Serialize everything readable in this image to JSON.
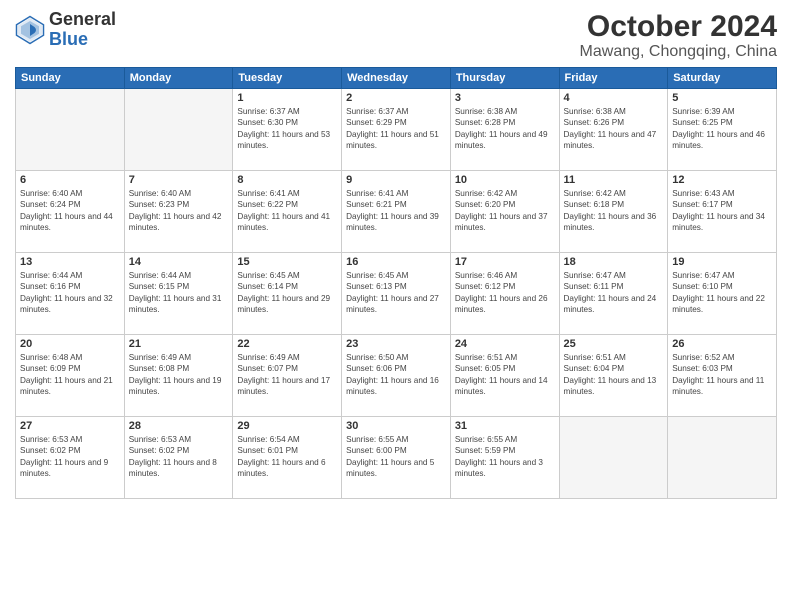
{
  "header": {
    "logo_line1": "General",
    "logo_line2": "Blue",
    "title": "October 2024",
    "subtitle": "Mawang, Chongqing, China"
  },
  "weekdays": [
    "Sunday",
    "Monday",
    "Tuesday",
    "Wednesday",
    "Thursday",
    "Friday",
    "Saturday"
  ],
  "weeks": [
    [
      {
        "day": "",
        "sunrise": "",
        "sunset": "",
        "daylight": ""
      },
      {
        "day": "",
        "sunrise": "",
        "sunset": "",
        "daylight": ""
      },
      {
        "day": "1",
        "sunrise": "Sunrise: 6:37 AM",
        "sunset": "Sunset: 6:30 PM",
        "daylight": "Daylight: 11 hours and 53 minutes."
      },
      {
        "day": "2",
        "sunrise": "Sunrise: 6:37 AM",
        "sunset": "Sunset: 6:29 PM",
        "daylight": "Daylight: 11 hours and 51 minutes."
      },
      {
        "day": "3",
        "sunrise": "Sunrise: 6:38 AM",
        "sunset": "Sunset: 6:28 PM",
        "daylight": "Daylight: 11 hours and 49 minutes."
      },
      {
        "day": "4",
        "sunrise": "Sunrise: 6:38 AM",
        "sunset": "Sunset: 6:26 PM",
        "daylight": "Daylight: 11 hours and 47 minutes."
      },
      {
        "day": "5",
        "sunrise": "Sunrise: 6:39 AM",
        "sunset": "Sunset: 6:25 PM",
        "daylight": "Daylight: 11 hours and 46 minutes."
      }
    ],
    [
      {
        "day": "6",
        "sunrise": "Sunrise: 6:40 AM",
        "sunset": "Sunset: 6:24 PM",
        "daylight": "Daylight: 11 hours and 44 minutes."
      },
      {
        "day": "7",
        "sunrise": "Sunrise: 6:40 AM",
        "sunset": "Sunset: 6:23 PM",
        "daylight": "Daylight: 11 hours and 42 minutes."
      },
      {
        "day": "8",
        "sunrise": "Sunrise: 6:41 AM",
        "sunset": "Sunset: 6:22 PM",
        "daylight": "Daylight: 11 hours and 41 minutes."
      },
      {
        "day": "9",
        "sunrise": "Sunrise: 6:41 AM",
        "sunset": "Sunset: 6:21 PM",
        "daylight": "Daylight: 11 hours and 39 minutes."
      },
      {
        "day": "10",
        "sunrise": "Sunrise: 6:42 AM",
        "sunset": "Sunset: 6:20 PM",
        "daylight": "Daylight: 11 hours and 37 minutes."
      },
      {
        "day": "11",
        "sunrise": "Sunrise: 6:42 AM",
        "sunset": "Sunset: 6:18 PM",
        "daylight": "Daylight: 11 hours and 36 minutes."
      },
      {
        "day": "12",
        "sunrise": "Sunrise: 6:43 AM",
        "sunset": "Sunset: 6:17 PM",
        "daylight": "Daylight: 11 hours and 34 minutes."
      }
    ],
    [
      {
        "day": "13",
        "sunrise": "Sunrise: 6:44 AM",
        "sunset": "Sunset: 6:16 PM",
        "daylight": "Daylight: 11 hours and 32 minutes."
      },
      {
        "day": "14",
        "sunrise": "Sunrise: 6:44 AM",
        "sunset": "Sunset: 6:15 PM",
        "daylight": "Daylight: 11 hours and 31 minutes."
      },
      {
        "day": "15",
        "sunrise": "Sunrise: 6:45 AM",
        "sunset": "Sunset: 6:14 PM",
        "daylight": "Daylight: 11 hours and 29 minutes."
      },
      {
        "day": "16",
        "sunrise": "Sunrise: 6:45 AM",
        "sunset": "Sunset: 6:13 PM",
        "daylight": "Daylight: 11 hours and 27 minutes."
      },
      {
        "day": "17",
        "sunrise": "Sunrise: 6:46 AM",
        "sunset": "Sunset: 6:12 PM",
        "daylight": "Daylight: 11 hours and 26 minutes."
      },
      {
        "day": "18",
        "sunrise": "Sunrise: 6:47 AM",
        "sunset": "Sunset: 6:11 PM",
        "daylight": "Daylight: 11 hours and 24 minutes."
      },
      {
        "day": "19",
        "sunrise": "Sunrise: 6:47 AM",
        "sunset": "Sunset: 6:10 PM",
        "daylight": "Daylight: 11 hours and 22 minutes."
      }
    ],
    [
      {
        "day": "20",
        "sunrise": "Sunrise: 6:48 AM",
        "sunset": "Sunset: 6:09 PM",
        "daylight": "Daylight: 11 hours and 21 minutes."
      },
      {
        "day": "21",
        "sunrise": "Sunrise: 6:49 AM",
        "sunset": "Sunset: 6:08 PM",
        "daylight": "Daylight: 11 hours and 19 minutes."
      },
      {
        "day": "22",
        "sunrise": "Sunrise: 6:49 AM",
        "sunset": "Sunset: 6:07 PM",
        "daylight": "Daylight: 11 hours and 17 minutes."
      },
      {
        "day": "23",
        "sunrise": "Sunrise: 6:50 AM",
        "sunset": "Sunset: 6:06 PM",
        "daylight": "Daylight: 11 hours and 16 minutes."
      },
      {
        "day": "24",
        "sunrise": "Sunrise: 6:51 AM",
        "sunset": "Sunset: 6:05 PM",
        "daylight": "Daylight: 11 hours and 14 minutes."
      },
      {
        "day": "25",
        "sunrise": "Sunrise: 6:51 AM",
        "sunset": "Sunset: 6:04 PM",
        "daylight": "Daylight: 11 hours and 13 minutes."
      },
      {
        "day": "26",
        "sunrise": "Sunrise: 6:52 AM",
        "sunset": "Sunset: 6:03 PM",
        "daylight": "Daylight: 11 hours and 11 minutes."
      }
    ],
    [
      {
        "day": "27",
        "sunrise": "Sunrise: 6:53 AM",
        "sunset": "Sunset: 6:02 PM",
        "daylight": "Daylight: 11 hours and 9 minutes."
      },
      {
        "day": "28",
        "sunrise": "Sunrise: 6:53 AM",
        "sunset": "Sunset: 6:02 PM",
        "daylight": "Daylight: 11 hours and 8 minutes."
      },
      {
        "day": "29",
        "sunrise": "Sunrise: 6:54 AM",
        "sunset": "Sunset: 6:01 PM",
        "daylight": "Daylight: 11 hours and 6 minutes."
      },
      {
        "day": "30",
        "sunrise": "Sunrise: 6:55 AM",
        "sunset": "Sunset: 6:00 PM",
        "daylight": "Daylight: 11 hours and 5 minutes."
      },
      {
        "day": "31",
        "sunrise": "Sunrise: 6:55 AM",
        "sunset": "Sunset: 5:59 PM",
        "daylight": "Daylight: 11 hours and 3 minutes."
      },
      {
        "day": "",
        "sunrise": "",
        "sunset": "",
        "daylight": ""
      },
      {
        "day": "",
        "sunrise": "",
        "sunset": "",
        "daylight": ""
      }
    ]
  ]
}
